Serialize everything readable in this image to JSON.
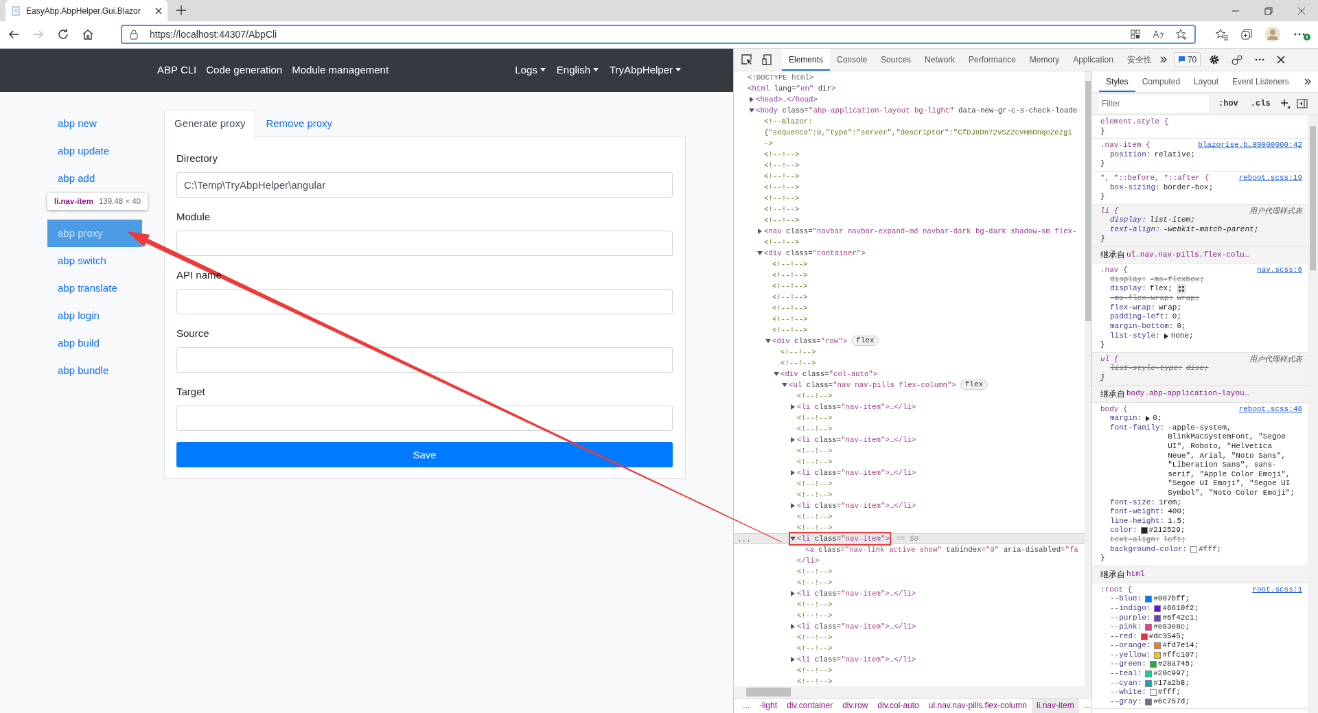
{
  "browser": {
    "tab_title": "EasyAbp.AbpHelper.Gui.Blazor",
    "url": "https://localhost:44307/AbpCli"
  },
  "app": {
    "nav_links": [
      "ABP CLI",
      "Code generation",
      "Module management"
    ],
    "nav_dropdowns": [
      "Logs",
      "English",
      "TryAbpHelper"
    ],
    "sidebar": [
      {
        "kind": "link",
        "label": "abp new",
        "selected": false
      },
      {
        "kind": "link",
        "label": "abp update",
        "selected": false
      },
      {
        "kind": "link",
        "label": "abp add",
        "selected": false
      },
      {
        "kind": "tooltip",
        "selector": "li.nav-item",
        "size": "139.48 × 40"
      },
      {
        "kind": "link",
        "label": "abp proxy",
        "selected": true
      },
      {
        "kind": "link",
        "label": "abp switch",
        "selected": false
      },
      {
        "kind": "link",
        "label": "abp translate",
        "selected": false
      },
      {
        "kind": "link",
        "label": "abp login",
        "selected": false
      },
      {
        "kind": "link",
        "label": "abp build",
        "selected": false
      },
      {
        "kind": "link",
        "label": "abp bundle",
        "selected": false
      }
    ],
    "tabs": [
      {
        "label": "Generate proxy",
        "selected": true
      },
      {
        "label": "Remove proxy",
        "selected": false
      }
    ],
    "fields": [
      {
        "label": "Directory",
        "value": "C:\\Temp\\TryAbpHelper\\angular"
      },
      {
        "label": "Module"
      },
      {
        "label": "API name"
      },
      {
        "label": "Source"
      },
      {
        "label": "Target"
      }
    ],
    "save_button": "Save"
  },
  "devtools": {
    "tabs": [
      {
        "label": "Elements",
        "selected": true
      },
      {
        "label": "Console",
        "selected": false
      },
      {
        "label": "Sources",
        "selected": false
      },
      {
        "label": "Network",
        "selected": false
      },
      {
        "label": "Performance",
        "selected": false
      },
      {
        "label": "Memory",
        "selected": false
      },
      {
        "label": "Application",
        "selected": false
      },
      {
        "label": "安全性",
        "selected": false
      }
    ],
    "issues_badge": "70",
    "dom_tree": [
      {
        "kind": "doctype",
        "text": "<!DOCTYPE html>",
        "selected": false
      },
      {
        "kind": "element",
        "text": "<html lang=\"en\" dir>",
        "selected": false,
        "children": [
          {
            "kind": "element",
            "text": "<head>…</head>",
            "expanded": false,
            "selected": false
          },
          {
            "kind": "element",
            "text": "<body class=\"abp-application-layout bg-light\" data-new-gr-c-s-check-loade",
            "expanded": true,
            "selected": false,
            "children": [
              {
                "kind": "comment",
                "text": "<!--Blazor:",
                "selected": false
              },
              {
                "kind": "comment",
                "text": "{\"sequence\":0,\"type\":\"server\",\"descriptor\":\"CfDJ8Dn72vSZZcVHmOnqoZezgi",
                "selected": false
              },
              {
                "kind": "comment",
                "text": "->",
                "selected": false
              },
              {
                "kind": "comment",
                "text": "<!--!-->",
                "selected": false
              },
              {
                "kind": "comment",
                "text": "<!--!-->",
                "selected": false
              },
              {
                "kind": "comment",
                "text": "<!--!-->",
                "selected": false
              },
              {
                "kind": "comment",
                "text": "<!--!-->",
                "selected": false
              },
              {
                "kind": "comment",
                "text": "<!--!-->",
                "selected": false
              },
              {
                "kind": "comment",
                "text": "<!--!-->",
                "selected": false
              },
              {
                "kind": "comment",
                "text": "<!--!-->",
                "selected": false
              },
              {
                "kind": "element",
                "text": "<nav class=\"navbar navbar-expand-md navbar-dark bg-dark shadow-sm flex-",
                "expanded": false,
                "selected": false
              },
              {
                "kind": "comment",
                "text": "<!--!-->",
                "selected": false
              },
              {
                "kind": "element",
                "text": "<div class=\"container\">",
                "expanded": true,
                "selected": false,
                "children": [
                  {
                    "kind": "comment",
                    "text": "<!--!-->",
                    "selected": false
                  },
                  {
                    "kind": "comment",
                    "text": "<!--!-->",
                    "selected": false
                  },
                  {
                    "kind": "comment",
                    "text": "<!--!-->",
                    "selected": false
                  },
                  {
                    "kind": "comment",
                    "text": "<!--!-->",
                    "selected": false
                  },
                  {
                    "kind": "comment",
                    "text": "<!--!-->",
                    "selected": false
                  },
                  {
                    "kind": "comment",
                    "text": "<!--!-->",
                    "selected": false
                  },
                  {
                    "kind": "comment",
                    "text": "<!--!-->",
                    "selected": false
                  },
                  {
                    "kind": "element",
                    "text": "<div class=\"row\">",
                    "badge": "flex",
                    "expanded": true,
                    "selected": false,
                    "children": [
                      {
                        "kind": "comment",
                        "text": "<!--!-->",
                        "selected": false
                      },
                      {
                        "kind": "comment",
                        "text": "<!--!-->",
                        "selected": false
                      },
                      {
                        "kind": "element",
                        "text": "<div class=\"col-auto\">",
                        "expanded": true,
                        "selected": false,
                        "children": [
                          {
                            "kind": "element",
                            "text": "<ul class=\"nav nav-pills flex-column\">",
                            "badge": "flex",
                            "expanded": true,
                            "selected": false,
                            "children": [
                              {
                                "kind": "comment",
                                "text": "<!--!-->",
                                "selected": false
                              },
                              {
                                "kind": "element",
                                "text": "<li class=\"nav-item\">…</li>",
                                "expanded": false,
                                "selected": false
                              },
                              {
                                "kind": "comment",
                                "text": "<!--!-->",
                                "selected": false
                              },
                              {
                                "kind": "comment",
                                "text": "<!--!-->",
                                "selected": false
                              },
                              {
                                "kind": "element",
                                "text": "<li class=\"nav-item\">…</li>",
                                "expanded": false,
                                "selected": false
                              },
                              {
                                "kind": "comment",
                                "text": "<!--!-->",
                                "selected": false
                              },
                              {
                                "kind": "comment",
                                "text": "<!--!-->",
                                "selected": false
                              },
                              {
                                "kind": "element",
                                "text": "<li class=\"nav-item\">…</li>",
                                "expanded": false,
                                "selected": false
                              },
                              {
                                "kind": "comment",
                                "text": "<!--!-->",
                                "selected": false
                              },
                              {
                                "kind": "comment",
                                "text": "<!--!-->",
                                "selected": false
                              },
                              {
                                "kind": "element",
                                "text": "<li class=\"nav-item\">…</li>",
                                "expanded": false,
                                "selected": false
                              },
                              {
                                "kind": "comment",
                                "text": "<!--!-->",
                                "selected": false
                              },
                              {
                                "kind": "comment",
                                "text": "<!--!-->",
                                "selected": false
                              },
                              {
                                "kind": "element",
                                "text": "<li class=\"nav-item\">",
                                "expanded": true,
                                "selected": true,
                                "boxed": true,
                                "gutter_mark": "...",
                                "suffix": "== $0",
                                "closing": "</li>",
                                "children": [
                                  {
                                    "kind": "element",
                                    "text": "<a class=\"nav-link active show\" tabindex=\"0\" aria-disabled=\"fa",
                                    "selected": false
                                  }
                                ]
                              },
                              {
                                "kind": "comment",
                                "text": "<!--!-->",
                                "selected": false
                              },
                              {
                                "kind": "comment",
                                "text": "<!--!-->",
                                "selected": false
                              },
                              {
                                "kind": "element",
                                "text": "<li class=\"nav-item\">…</li>",
                                "expanded": false,
                                "selected": false
                              },
                              {
                                "kind": "comment",
                                "text": "<!--!-->",
                                "selected": false
                              },
                              {
                                "kind": "comment",
                                "text": "<!--!-->",
                                "selected": false
                              },
                              {
                                "kind": "element",
                                "text": "<li class=\"nav-item\">…</li>",
                                "expanded": false,
                                "selected": false
                              },
                              {
                                "kind": "comment",
                                "text": "<!--!-->",
                                "selected": false
                              },
                              {
                                "kind": "comment",
                                "text": "<!--!-->",
                                "selected": false
                              },
                              {
                                "kind": "element",
                                "text": "<li class=\"nav-item\">…</li>",
                                "expanded": false,
                                "selected": false
                              },
                              {
                                "kind": "comment",
                                "text": "<!--!-->",
                                "selected": false
                              },
                              {
                                "kind": "comment",
                                "text": "<!--!-->",
                                "selected": false
                              }
                            ]
                          }
                        ]
                      }
                    ]
                  }
                ]
              }
            ]
          }
        ]
      }
    ],
    "breadcrumbs": [
      {
        "label": "...",
        "selected": false
      },
      {
        "label": "-light",
        "selected": false
      },
      {
        "label": "div.container",
        "selected": false
      },
      {
        "label": "div.row",
        "selected": false
      },
      {
        "label": "div.col-auto",
        "selected": false
      },
      {
        "label": "ul.nav.nav-pills.flex-column",
        "selected": false
      },
      {
        "label": "li.nav-item",
        "selected": true
      },
      {
        "label": "...",
        "selected": false
      }
    ],
    "styles": {
      "tabs": [
        {
          "label": "Styles",
          "selected": true
        },
        {
          "label": "Computed",
          "selected": false
        },
        {
          "label": "Layout",
          "selected": false
        },
        {
          "label": "Event Listeners",
          "selected": false
        }
      ],
      "filter_placeholder": "Filter",
      "state_toggle": ":hov",
      "class_toggle": ".cls",
      "rules": [
        {
          "kind": "rule",
          "selector": "element.style {",
          "closing": "}"
        },
        {
          "kind": "rule",
          "selector": ".nav-item {",
          "source": "blazorise.b…80000000:42",
          "closing": "}",
          "properties": [
            {
              "name": "position:",
              "value": "relative;",
              "overridden": false
            }
          ]
        },
        {
          "kind": "rule",
          "selector": "*, *::before, *::after {",
          "source": "reboot.scss:19",
          "closing": "}",
          "properties": [
            {
              "name": "box-sizing:",
              "value": "border-box;",
              "overridden": false
            }
          ]
        },
        {
          "kind": "user-agent",
          "selector": "li {",
          "source": "用户代理样式表",
          "closing": "}",
          "properties": [
            {
              "name": "display:",
              "value": "list-item;",
              "overridden": false
            },
            {
              "name": "text-align:",
              "value": "-webkit-match-parent;",
              "overridden": false
            }
          ]
        },
        {
          "kind": "inherited",
          "label": "继承自",
          "from": "ul.nav.nav-pills.flex-colu…"
        },
        {
          "kind": "rule",
          "selector": ".nav {",
          "source": "nav.scss:6",
          "closing": "}",
          "properties": [
            {
              "name": "display:",
              "value": "-ms-flexbox;",
              "overridden": true
            },
            {
              "name": "display:",
              "value": "flex;",
              "overridden": false,
              "flex_editor": true
            },
            {
              "name": "-ms-flex-wrap:",
              "value": "wrap;",
              "overridden": true
            },
            {
              "name": "flex-wrap:",
              "value": "wrap;",
              "overridden": false
            },
            {
              "name": "padding-left:",
              "value": "0;",
              "overridden": false
            },
            {
              "name": "margin-bottom:",
              "value": "0;",
              "overridden": false
            },
            {
              "name": "list-style:",
              "value": "none;",
              "overridden": false,
              "expandable": true
            }
          ]
        },
        {
          "kind": "user-agent",
          "selector": "ul {",
          "source": "用户代理样式表",
          "closing": "}",
          "properties": [
            {
              "name": "list-style-type:",
              "value": "disc;",
              "overridden": true
            }
          ]
        },
        {
          "kind": "inherited",
          "label": "继承自",
          "from": "body.abp-application-layou…"
        },
        {
          "kind": "rule",
          "selector": "body {",
          "source": "reboot.scss:46",
          "closing": "}",
          "properties": [
            {
              "name": "margin:",
              "value": "0;",
              "overridden": false,
              "expandable": true
            },
            {
              "name": "font-family:",
              "value": "-apple-system, BlinkMacSystemFont, \"Segoe UI\", Roboto, \"Helvetica Neue\", Arial, \"Noto Sans\", \"Liberation Sans\", sans-serif, \"Apple Color Emoji\", \"Segoe UI Emoji\", \"Segoe UI Symbol\", \"Noto Color Emoji\";",
              "overridden": false
            },
            {
              "name": "font-size:",
              "value": "1rem;",
              "overridden": false
            },
            {
              "name": "font-weight:",
              "value": "400;",
              "overridden": false
            },
            {
              "name": "line-height:",
              "value": "1.5;",
              "overridden": false
            },
            {
              "name": "color:",
              "value": "#212529;",
              "overridden": false,
              "color": "#212529"
            },
            {
              "name": "text-align:",
              "value": "left;",
              "overridden": true
            },
            {
              "name": "background-color:",
              "value": "#fff;",
              "overridden": false,
              "color": "#ffffff"
            }
          ]
        },
        {
          "kind": "inherited",
          "label": "继承自",
          "from": "html"
        },
        {
          "kind": "rule",
          "selector": ":root {",
          "source": "root.scss:1",
          "properties": [
            {
              "name": "--blue:",
              "value": "#007bff;",
              "overridden": false,
              "color": "#007bff"
            },
            {
              "name": "--indigo:",
              "value": "#6610f2;",
              "overridden": false,
              "color": "#6610f2"
            },
            {
              "name": "--purple:",
              "value": "#6f42c1;",
              "overridden": false,
              "color": "#6f42c1"
            },
            {
              "name": "--pink:",
              "value": "#e83e8c;",
              "overridden": false,
              "color": "#e83e8c"
            },
            {
              "name": "--red:",
              "value": "#dc3545;",
              "overridden": false,
              "color": "#dc3545"
            },
            {
              "name": "--orange:",
              "value": "#fd7e14;",
              "overridden": false,
              "color": "#fd7e14"
            },
            {
              "name": "--yellow:",
              "value": "#ffc107;",
              "overridden": false,
              "color": "#ffc107"
            },
            {
              "name": "--green:",
              "value": "#28a745;",
              "overridden": false,
              "color": "#28a745"
            },
            {
              "name": "--teal:",
              "value": "#20c997;",
              "overridden": false,
              "color": "#20c997"
            },
            {
              "name": "--cyan:",
              "value": "#17a2b8;",
              "overridden": false,
              "color": "#17a2b8"
            },
            {
              "name": "--white:",
              "value": "#fff;",
              "overridden": false,
              "color": "#ffffff"
            },
            {
              "name": "--gray:",
              "value": "#6c757d;",
              "overridden": false,
              "color": "#6c757d"
            }
          ]
        }
      ]
    }
  }
}
